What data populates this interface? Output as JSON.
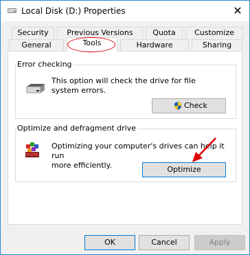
{
  "window": {
    "title": "Local Disk (D:) Properties",
    "close_glyph": "✕"
  },
  "tabs_top": [
    {
      "label": "Security"
    },
    {
      "label": "Previous Versions"
    },
    {
      "label": "Quota"
    },
    {
      "label": "Customize"
    }
  ],
  "tabs_bottom": [
    {
      "label": "General"
    },
    {
      "label": "Tools"
    },
    {
      "label": "Hardware"
    },
    {
      "label": "Sharing"
    }
  ],
  "error_checking": {
    "title": "Error checking",
    "description_line1": "This option will check the drive for file",
    "description_line2": "system errors.",
    "button_label": "Check"
  },
  "optimize": {
    "title": "Optimize and defragment drive",
    "description_line1": "Optimizing your computer's drives can help it run",
    "description_line2": "more efficiently.",
    "button_label": "Optimize"
  },
  "footer": {
    "ok": "OK",
    "cancel": "Cancel",
    "apply": "Apply"
  },
  "colors": {
    "window_border": "#2b87d3",
    "highlight_red": "#e00000",
    "button_focus": "#0078d7"
  }
}
